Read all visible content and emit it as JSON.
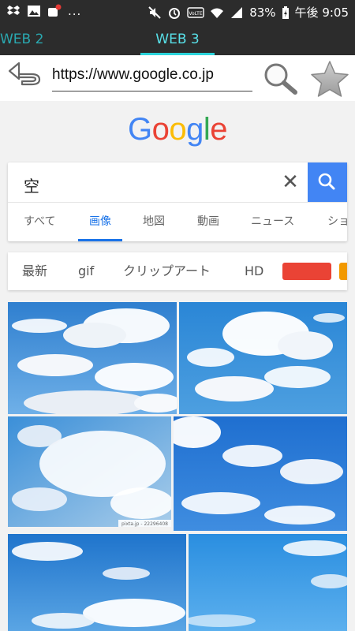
{
  "status_bar": {
    "left_icons": [
      "dropbox-icon",
      "image-icon",
      "notification-icon"
    ],
    "overflow": "...",
    "right_icons": [
      "mute-icon",
      "alarm-icon",
      "volte-icon",
      "wifi-icon",
      "signal-icon",
      "battery-icon"
    ],
    "volte_label": "VoLTE",
    "battery": "83%",
    "time": "午後 9:05"
  },
  "tabs": [
    {
      "label": "WEB 2",
      "active": false
    },
    {
      "label": "WEB 3",
      "active": true
    }
  ],
  "toolbar": {
    "back_icon": "back-arrow-icon",
    "url": "https://www.google.co.jp",
    "search_icon": "magnifier-icon",
    "bookmark_icon": "star-icon"
  },
  "google": {
    "logo_letters": [
      "G",
      "o",
      "o",
      "g",
      "l",
      "e"
    ],
    "logo_colors": [
      "#4285f4",
      "#ea4335",
      "#fbbc05",
      "#4285f4",
      "#34a853",
      "#ea4335"
    ],
    "query": "空",
    "clear": "✕",
    "search_button_color": "#4285f4",
    "tabs": [
      {
        "label": "すべて",
        "active": false
      },
      {
        "label": "画像",
        "active": true
      },
      {
        "label": "地図",
        "active": false
      },
      {
        "label": "動画",
        "active": false
      },
      {
        "label": "ニュース",
        "active": false
      },
      {
        "label": "ショ",
        "active": false
      }
    ]
  },
  "filters": {
    "chips": [
      "最新",
      "gif",
      "クリップアート",
      "HD"
    ],
    "color_swatches": [
      "#ea4335",
      "#f29900"
    ]
  },
  "results": {
    "watermark": "pixta.jp - 22296408"
  }
}
